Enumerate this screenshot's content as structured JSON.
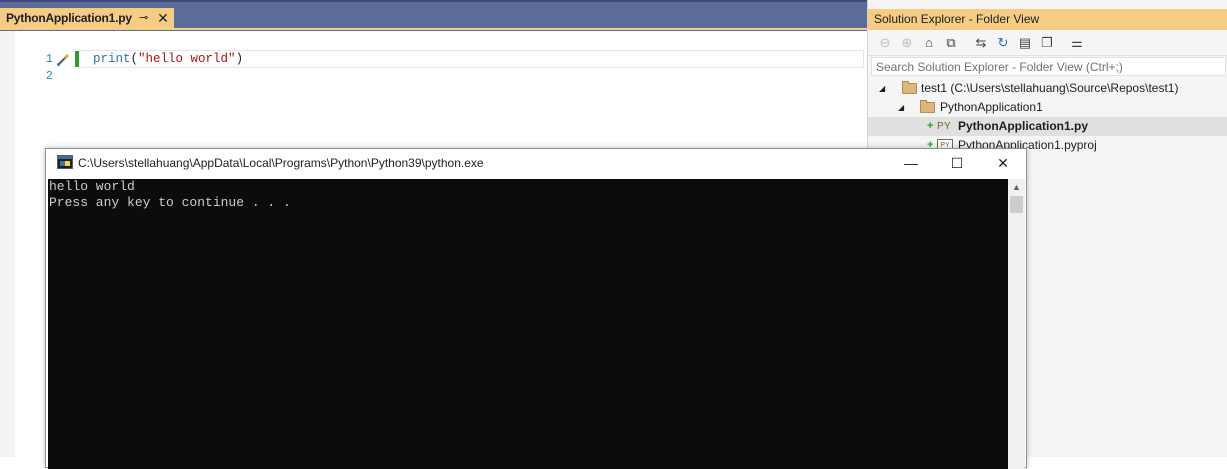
{
  "editor": {
    "tab": {
      "title": "PythonApplication1.py",
      "pin_glyph": "⊸",
      "close_glyph": "✕"
    },
    "line_numbers": [
      "1",
      "2"
    ],
    "code": {
      "fn": "print",
      "open": "(",
      "str": "\"hello world\"",
      "close": ")"
    }
  },
  "solution_explorer": {
    "title": "Solution Explorer - Folder View",
    "search_placeholder": "Search Solution Explorer - Folder View (Ctrl+;)",
    "toolbar_icons": [
      "back-icon",
      "forward-icon",
      "home-icon",
      "switch-views-icon",
      "sync-icon",
      "refresh-icon",
      "collapse-all-icon",
      "show-all-files-icon",
      "properties-icon"
    ],
    "tree": {
      "root": "test1 (C:\\Users\\stellahuang\\Source\\Repos\\test1)",
      "folder": "PythonApplication1",
      "file_py": "PythonApplication1.py",
      "file_py_tag": "PY",
      "file_pyproj": "PythonApplication1.pyproj",
      "added_marker": "+"
    }
  },
  "console": {
    "title": "C:\\Users\\stellahuang\\AppData\\Local\\Programs\\Python\\Python39\\python.exe",
    "lines": [
      "hello world",
      "Press any key to continue . . ."
    ],
    "buttons": {
      "minimize": "—",
      "maximize": "☐",
      "close": "✕"
    }
  },
  "colors": {
    "tab_active": "#f5cc84",
    "tab_strip": "#5d6b99",
    "console_bg": "#0c0c0c",
    "console_fg": "#cccccc"
  }
}
